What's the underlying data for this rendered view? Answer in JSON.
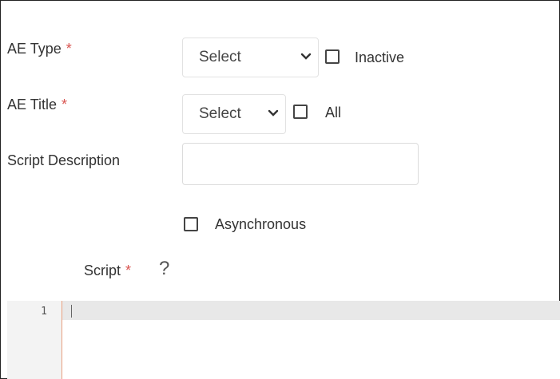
{
  "form": {
    "ae_type": {
      "label": "AE Type",
      "required_mark": "*",
      "select_value": "Select",
      "checkbox_label": "Inactive",
      "checkbox_checked": false
    },
    "ae_title": {
      "label": "AE Title",
      "required_mark": "*",
      "select_value": "Select",
      "checkbox_label": "All",
      "checkbox_checked": false
    },
    "script_description": {
      "label": "Script Description",
      "value": ""
    },
    "asynchronous": {
      "label": "Asynchronous",
      "checked": false
    },
    "script": {
      "label": "Script",
      "required_mark": "*",
      "help_icon": "?"
    }
  },
  "editor": {
    "line_numbers": [
      "1"
    ],
    "content": ""
  },
  "colors": {
    "required": "#d9534f",
    "gutter_border": "#e8a080"
  }
}
